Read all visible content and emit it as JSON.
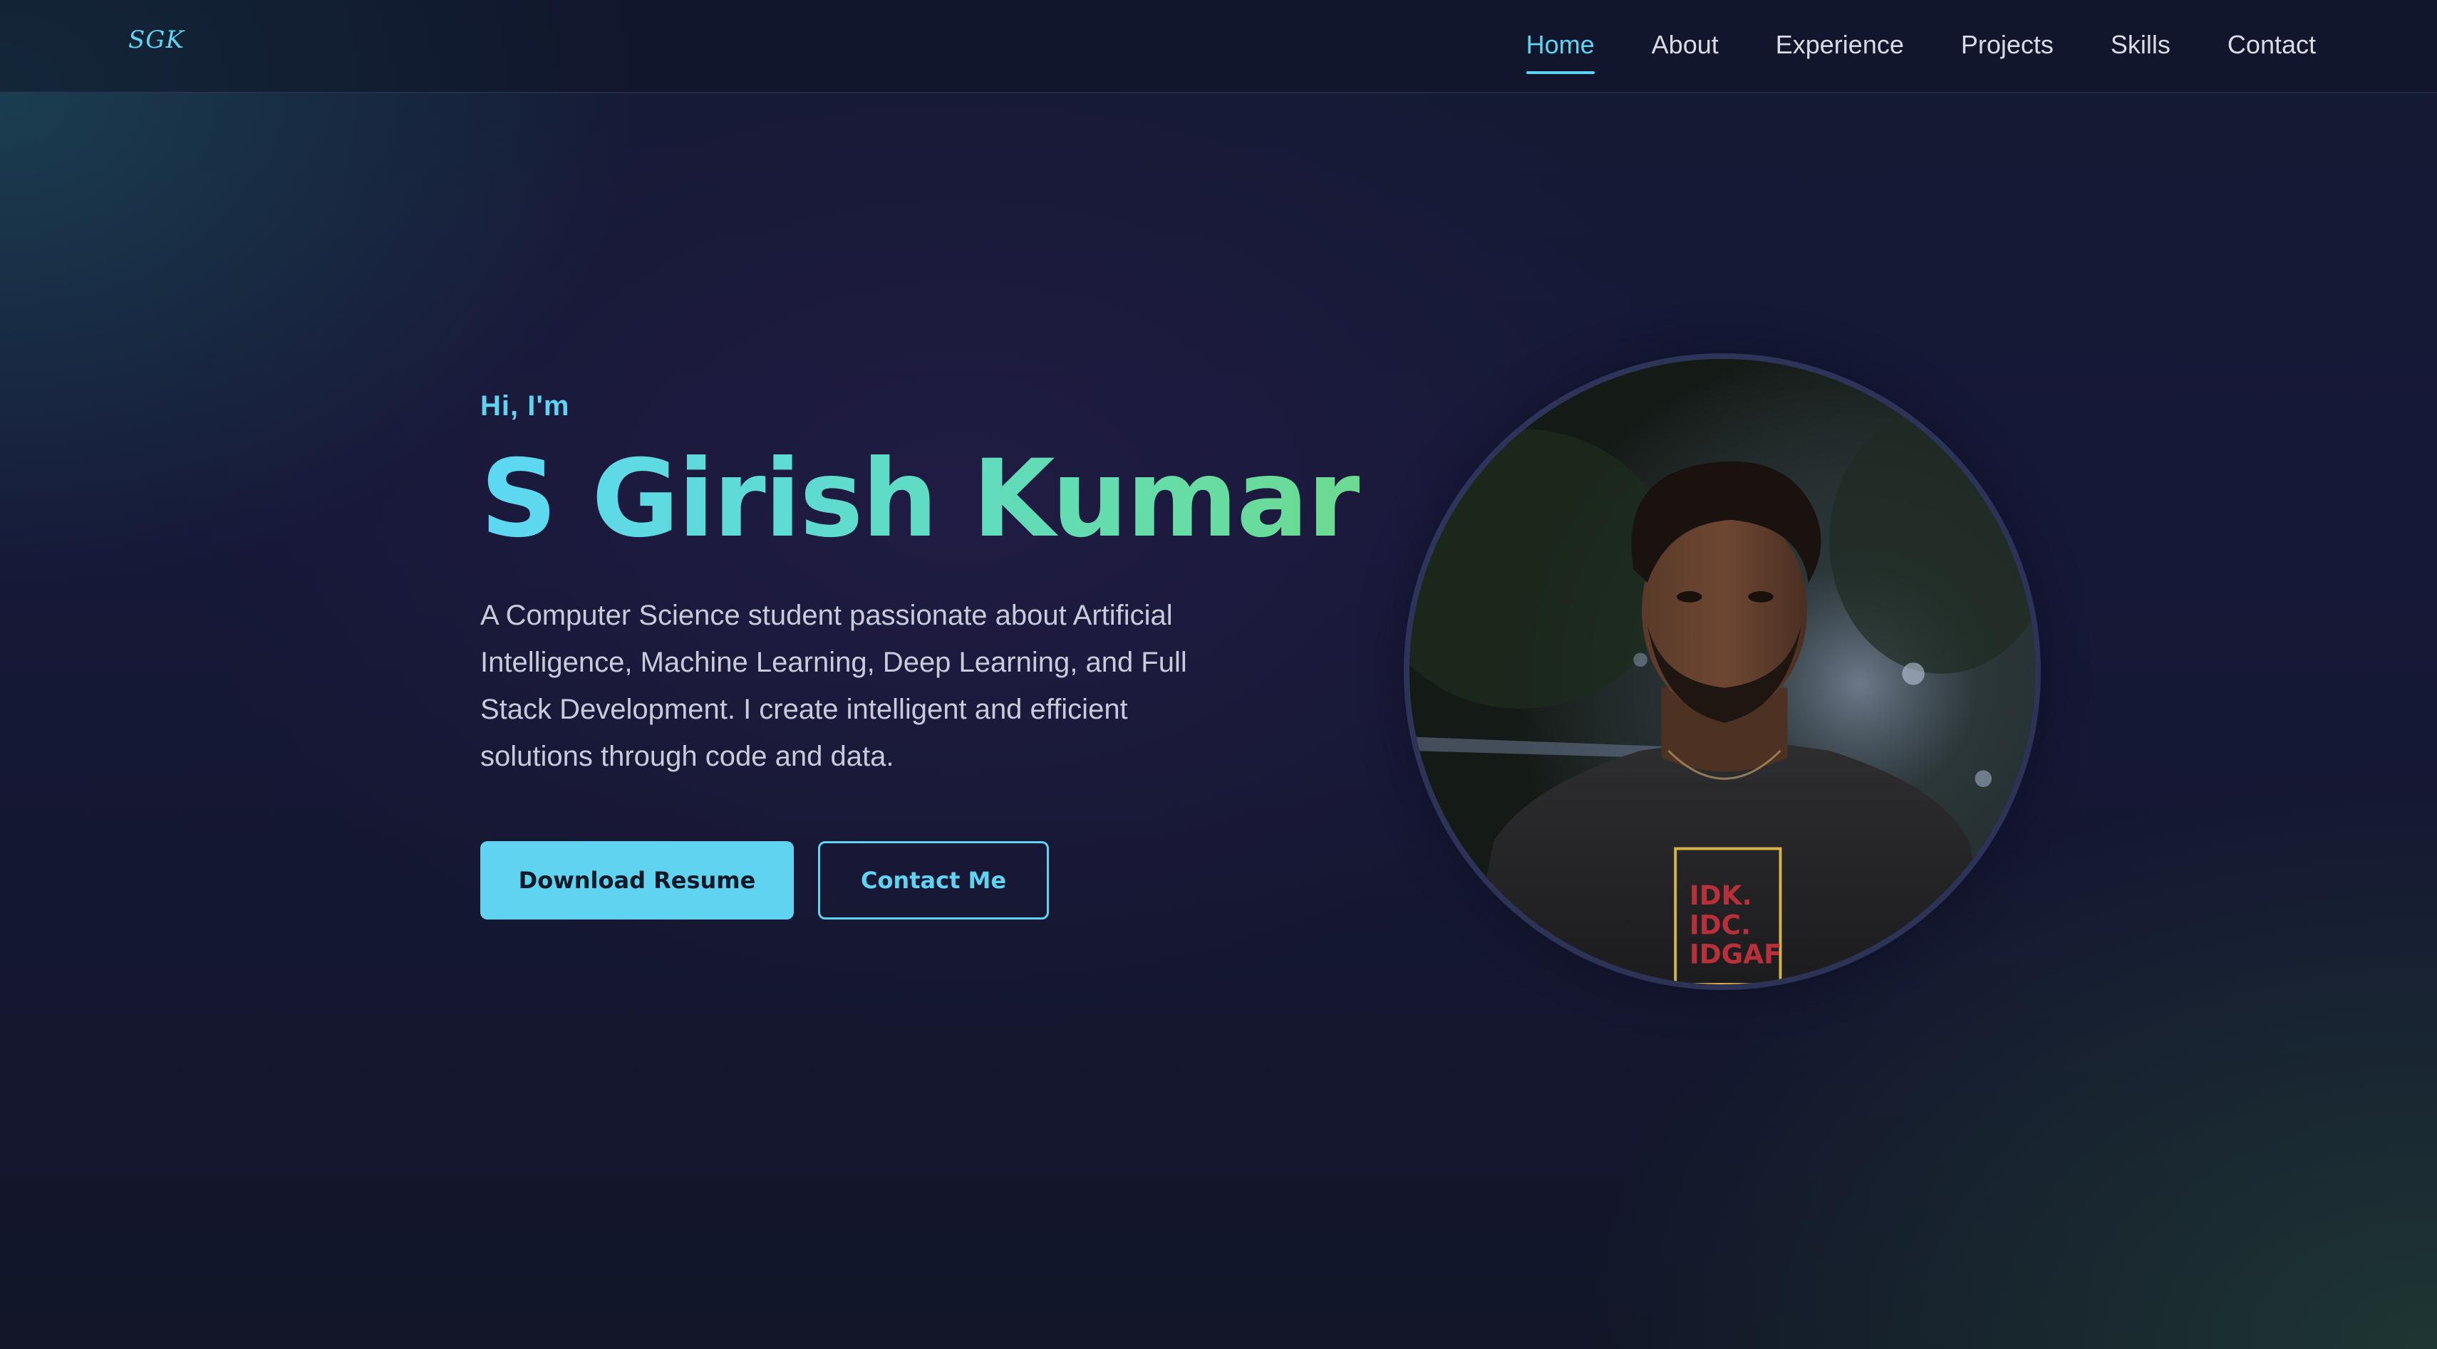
{
  "nav": {
    "logo": "SGK",
    "links": [
      {
        "label": "Home",
        "active": true
      },
      {
        "label": "About"
      },
      {
        "label": "Experience"
      },
      {
        "label": "Projects"
      },
      {
        "label": "Skills"
      },
      {
        "label": "Contact"
      }
    ]
  },
  "hero": {
    "greeting": "Hi, I'm",
    "name": "S Girish Kumar",
    "description": "A Computer Science student passionate about Artificial Intelligence, Machine Learning, Deep Learning, and Full Stack Development. I create intelligent and efficient solutions through code and data.",
    "primary_button": "Download Resume",
    "secondary_button": "Contact Me",
    "shirt_text": [
      "IDK.",
      "IDC.",
      "IDGAF"
    ]
  },
  "colors": {
    "accent": "#5fd3ef",
    "gradient_start": "#5dd8f4",
    "gradient_end": "#6ddb8a",
    "background": "#12172b"
  }
}
